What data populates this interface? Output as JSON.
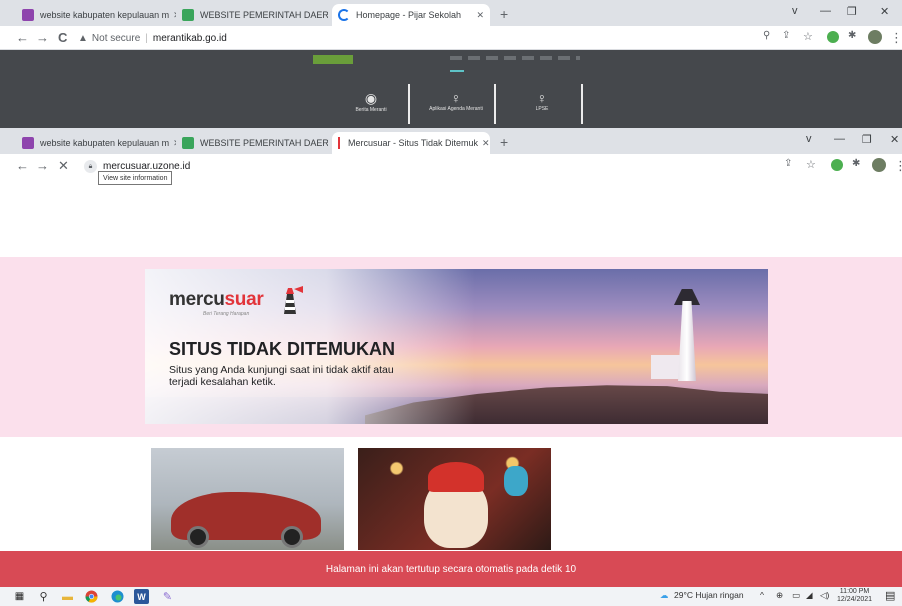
{
  "browser_top": {
    "tabs": [
      {
        "title": "website kabupaten kepulauan m",
        "favicon_color": "#8e44ad"
      },
      {
        "title": "WEBSITE PEMERINTAH DAERAH",
        "favicon_color": "#3aa55b"
      },
      {
        "title": "Homepage - Pijar Sekolah",
        "favicon_color": "#1a73e8",
        "active": true
      }
    ],
    "new_tab_label": "+",
    "window_controls": [
      "v",
      "—",
      "❐",
      "✕"
    ],
    "nav": {
      "back": "←",
      "forward": "→",
      "reload": "C"
    },
    "security_label": "Not secure",
    "url": "merantikab.go.id"
  },
  "site_behind": {
    "cards": [
      {
        "label": "Berita Meranti",
        "icon": "eye-icon"
      },
      {
        "label": "Aplikasi Agenda Meranti",
        "icon": "bulb-icon"
      },
      {
        "label": "LPSE",
        "icon": "bulb-icon"
      }
    ]
  },
  "browser_front": {
    "tabs": [
      {
        "title": "website kabupaten kepulauan m",
        "favicon_color": "#8e44ad"
      },
      {
        "title": "WEBSITE PEMERINTAH DAERAH",
        "favicon_color": "#3aa55b"
      },
      {
        "title": "Mercusuar - Situs Tidak Ditemuk",
        "favicon_color": "#e2343a",
        "active": true
      }
    ],
    "new_tab_label": "+",
    "window_controls": [
      "v",
      "—",
      "❐",
      "✕"
    ],
    "nav": {
      "back": "←",
      "forward": "→",
      "stop": "✕"
    },
    "url": "mercusuar.uzone.id",
    "tooltip": "View site information"
  },
  "error_page": {
    "brand_prefix": "mercu",
    "brand_suffix": "suar",
    "brand_tagline": "Beri Terang Harapan",
    "title": "SITUS TIDAK DITEMUKAN",
    "description": "Situs yang Anda kunjungi saat ini tidak aktif atau terjadi kesalahan ketik.",
    "countdown": "Halaman ini akan tertutup secara otomatis pada detik 10"
  },
  "taskbar": {
    "weather": "29°C  Hujan ringan",
    "time": "11:00 PM",
    "date": "12/24/2021"
  },
  "colors": {
    "accent_red": "#d84a55",
    "brand_red": "#e2343a",
    "banner_pink": "#fbe0ec"
  }
}
